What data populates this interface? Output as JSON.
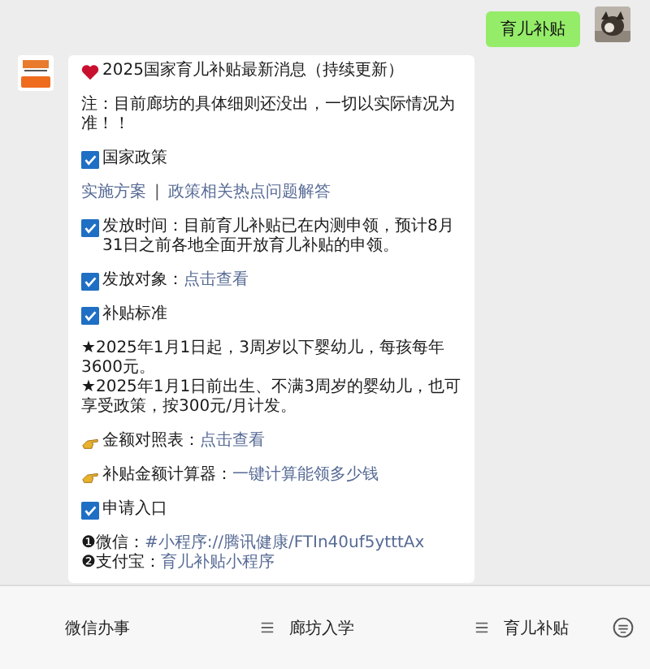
{
  "outgoing": {
    "text": "育儿补贴"
  },
  "message": {
    "paragraphs": [
      {
        "kind": "title",
        "lines": [
          {
            "label": "2025国家育儿补贴最新消息（持续更新）"
          }
        ]
      },
      {
        "kind": "text",
        "lines": [
          {
            "label": "注：目前廊坊的具体细则还没出，一切以实际情况为准！！"
          }
        ]
      },
      {
        "kind": "check",
        "lines": [
          {
            "label": "国家政策"
          }
        ]
      },
      {
        "kind": "links",
        "separator": "|",
        "lines": [
          {
            "link": "实施方案"
          },
          {
            "link": "政策相关热点问题解答"
          }
        ]
      },
      {
        "kind": "check",
        "lines": [
          {
            "label": "发放时间：目前育儿补贴已在内测申领，预计8月31日之前各地全面开放育儿补贴的申领。"
          }
        ]
      },
      {
        "kind": "check",
        "lines": [
          {
            "label": "发放对象：",
            "link": "点击查看"
          }
        ]
      },
      {
        "kind": "check",
        "lines": [
          {
            "label": "补贴标准"
          }
        ]
      },
      {
        "kind": "text",
        "lines": [
          {
            "label": "★2025年1月1日起，3周岁以下婴幼儿，每孩每年3600元。"
          },
          {
            "label": "★2025年1月1日前出生、不满3周岁的婴幼儿，也可享受政策，按300元/月计发。"
          }
        ]
      },
      {
        "kind": "point",
        "lines": [
          {
            "label": "金额对照表：",
            "link": "点击查看"
          }
        ]
      },
      {
        "kind": "point",
        "lines": [
          {
            "label": "补贴金额计算器：",
            "link": "一键计算能领多少钱"
          }
        ]
      },
      {
        "kind": "check",
        "lines": [
          {
            "label": "申请入口"
          }
        ]
      },
      {
        "kind": "text",
        "lines": [
          {
            "label": "❶微信：",
            "link": "#小程序://腾讯健康/FTIn40uf5ytttAx"
          },
          {
            "label": "❷支付宝：",
            "link": "育儿补贴小程序"
          }
        ]
      }
    ]
  },
  "menu": [
    {
      "label": "微信办事",
      "submenu": false
    },
    {
      "label": "廊坊入学",
      "submenu": true
    },
    {
      "label": "育儿补贴",
      "submenu": true
    }
  ]
}
